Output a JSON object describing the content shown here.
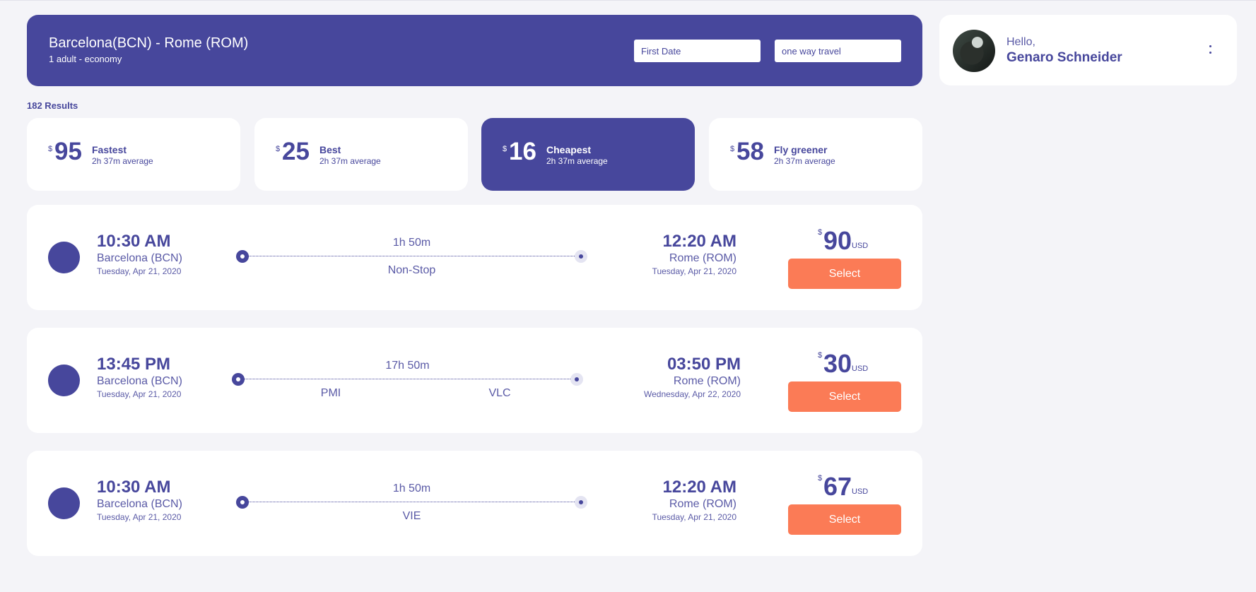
{
  "header": {
    "route": "Barcelona(BCN) - Rome (ROM)",
    "passengers": "1 adult - economy",
    "date_placeholder": "First Date",
    "trip_type_placeholder": "one way travel"
  },
  "user": {
    "greeting": "Hello,",
    "name": "Genaro Schneider"
  },
  "results_count": "182 Results",
  "sort_options": [
    {
      "currency": "$",
      "amount": "95",
      "label": "Fastest",
      "sub": "2h 37m average",
      "active": false
    },
    {
      "currency": "$",
      "amount": "25",
      "label": "Best",
      "sub": "2h 37m average",
      "active": false
    },
    {
      "currency": "$",
      "amount": "16",
      "label": "Cheapest",
      "sub": "2h 37m average",
      "active": true
    },
    {
      "currency": "$",
      "amount": "58",
      "label": "Fly greener",
      "sub": "2h 37m average",
      "active": false
    }
  ],
  "flights": [
    {
      "dep_time": "10:30 AM",
      "dep_city": "Barcelona (BCN)",
      "dep_date": "Tuesday, Apr 21, 2020",
      "duration": "1h 50m",
      "stops": [
        "Non-Stop"
      ],
      "arr_time": "12:20 AM",
      "arr_city": "Rome (ROM)",
      "arr_date": "Tuesday, Apr 21, 2020",
      "currency": "$",
      "price": "90",
      "price_unit": "USD",
      "select_label": "Select"
    },
    {
      "dep_time": "13:45 PM",
      "dep_city": "Barcelona (BCN)",
      "dep_date": "Tuesday, Apr 21, 2020",
      "duration": "17h 50m",
      "stops": [
        "PMI",
        "VLC"
      ],
      "arr_time": "03:50 PM",
      "arr_city": "Rome (ROM)",
      "arr_date": "Wednesday, Apr 22, 2020",
      "currency": "$",
      "price": "30",
      "price_unit": "USD",
      "select_label": "Select"
    },
    {
      "dep_time": "10:30 AM",
      "dep_city": "Barcelona (BCN)",
      "dep_date": "Tuesday, Apr 21, 2020",
      "duration": "1h 50m",
      "stops": [
        "VIE"
      ],
      "arr_time": "12:20 AM",
      "arr_city": "Rome (ROM)",
      "arr_date": "Tuesday, Apr 21, 2020",
      "currency": "$",
      "price": "67",
      "price_unit": "USD",
      "select_label": "Select"
    }
  ],
  "colors": {
    "brand": "#47479c",
    "accent": "#fb7b56",
    "background": "#f4f4f8"
  }
}
